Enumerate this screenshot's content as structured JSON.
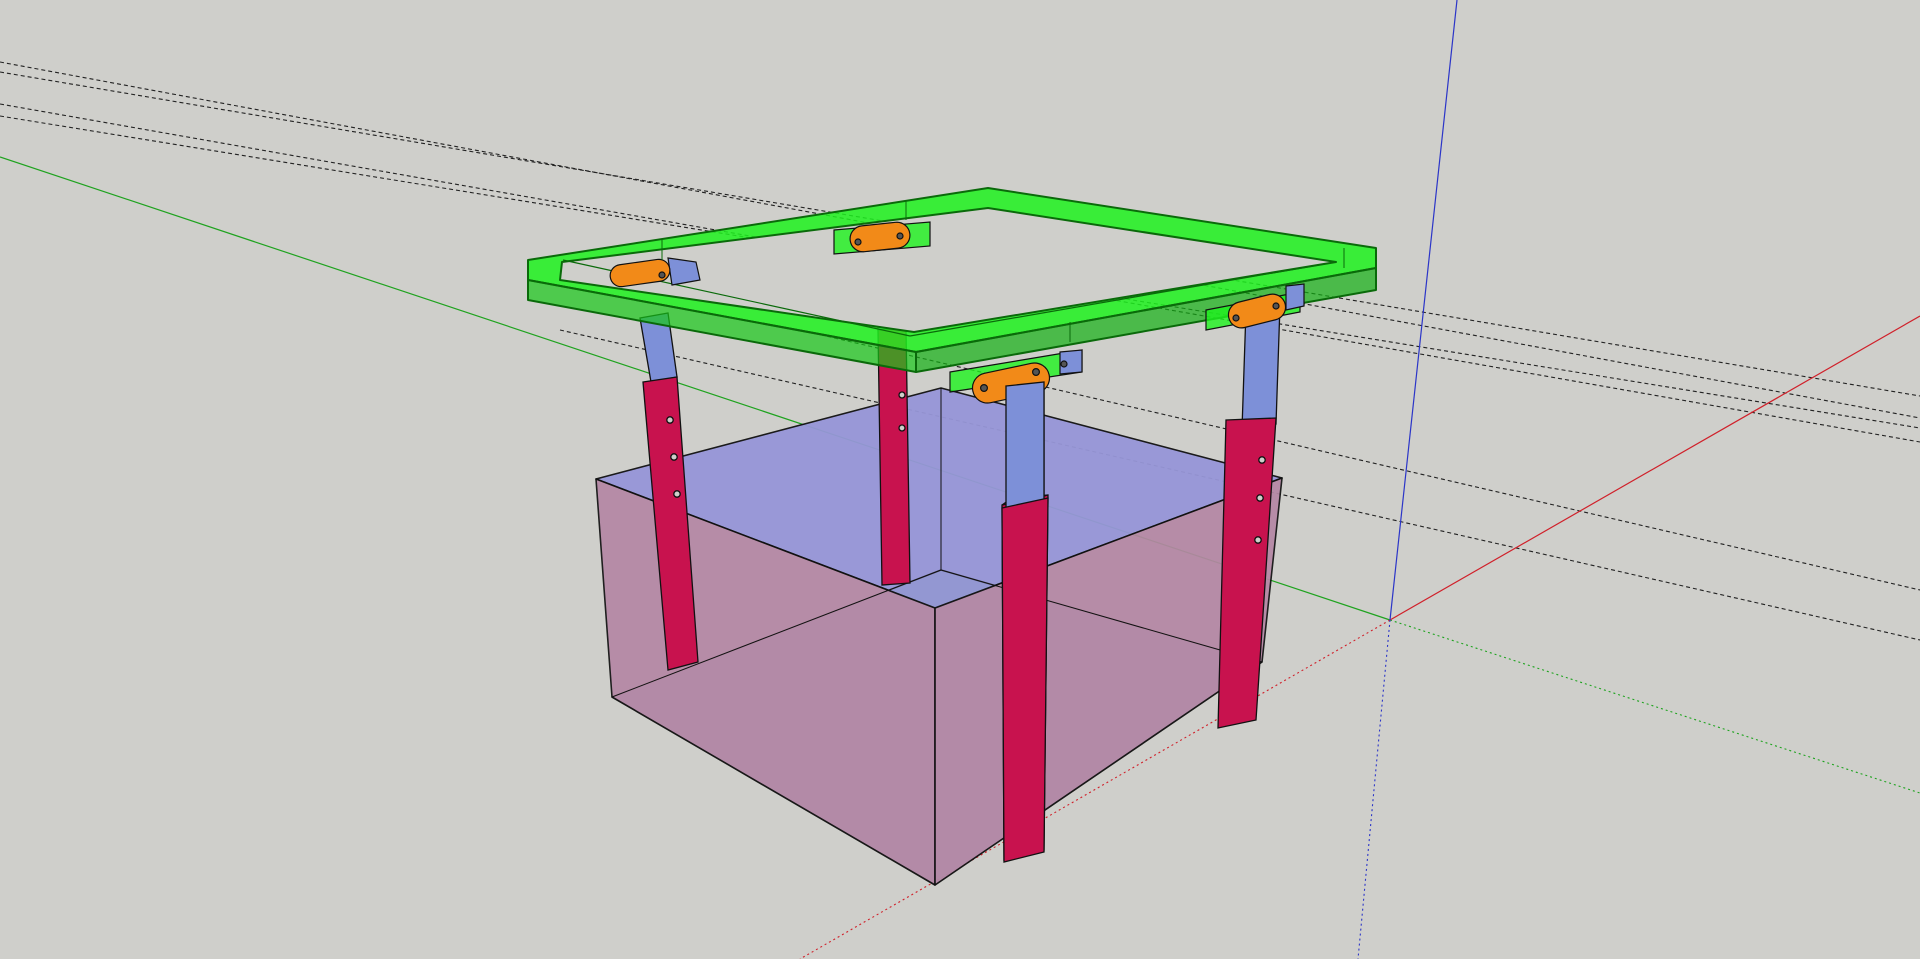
{
  "viewport": {
    "label": "",
    "background": "#cfcfcb"
  },
  "axes": {
    "red": "#d0202a",
    "green": "#1fa31f",
    "blue": "#2b35c8"
  },
  "colors": {
    "frame": "#1ef21e",
    "frame_edge": "#0a6a0a",
    "bracket": "#f28a18",
    "upper_leg": "#7d90d8",
    "lower_leg": "#c8124e",
    "box_top": "#9796d8",
    "box_side": "#b487a4",
    "box_floor": "#8e97cf",
    "guide_line": "#222222"
  },
  "model": {
    "parts": [
      "table-frame",
      "leg-front-left",
      "leg-back-left",
      "leg-front-right",
      "leg-back-right",
      "storage-box"
    ]
  }
}
